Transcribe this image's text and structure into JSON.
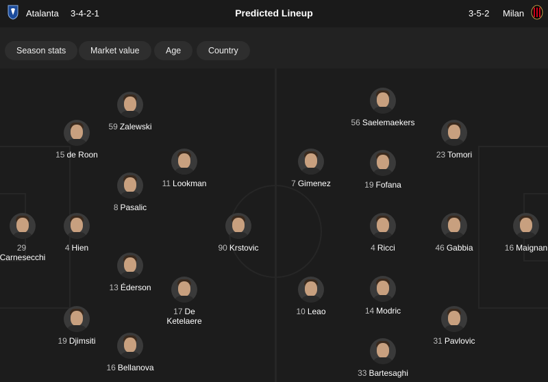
{
  "header": {
    "home_team": "Atalanta",
    "home_formation": "3-4-2-1",
    "title": "Predicted Lineup",
    "away_formation": "3-5-2",
    "away_team": "Milan",
    "home_crest_icon": "atalanta-crest-icon",
    "away_crest_icon": "milan-crest-icon"
  },
  "filters": [
    "Season stats",
    "Market value",
    "Age",
    "Country"
  ],
  "home_players": [
    {
      "number": "29",
      "name": "Carnesecchi"
    },
    {
      "number": "15",
      "name": "de Roon"
    },
    {
      "number": "4",
      "name": "Hien"
    },
    {
      "number": "19",
      "name": "Djimsiti"
    },
    {
      "number": "59",
      "name": "Zalewski"
    },
    {
      "number": "8",
      "name": "Pasalic"
    },
    {
      "number": "13",
      "name": "Éderson"
    },
    {
      "number": "16",
      "name": "Bellanova"
    },
    {
      "number": "11",
      "name": "Lookman"
    },
    {
      "number": "17",
      "name": "De Ketelaere"
    },
    {
      "number": "90",
      "name": "Krstovic"
    }
  ],
  "away_players": [
    {
      "number": "16",
      "name": "Maignan"
    },
    {
      "number": "23",
      "name": "Tomori"
    },
    {
      "number": "46",
      "name": "Gabbia"
    },
    {
      "number": "31",
      "name": "Pavlovic"
    },
    {
      "number": "56",
      "name": "Saelemaekers"
    },
    {
      "number": "19",
      "name": "Fofana"
    },
    {
      "number": "4",
      "name": "Ricci"
    },
    {
      "number": "14",
      "name": "Modric"
    },
    {
      "number": "33",
      "name": "Bartesaghi"
    },
    {
      "number": "7",
      "name": "Gimenez"
    },
    {
      "number": "10",
      "name": "Leao"
    }
  ],
  "colors": {
    "background": "#1a1a1a",
    "pill": "#2e2e2e",
    "text": "#ffffff",
    "number": "#bdbdbd"
  }
}
